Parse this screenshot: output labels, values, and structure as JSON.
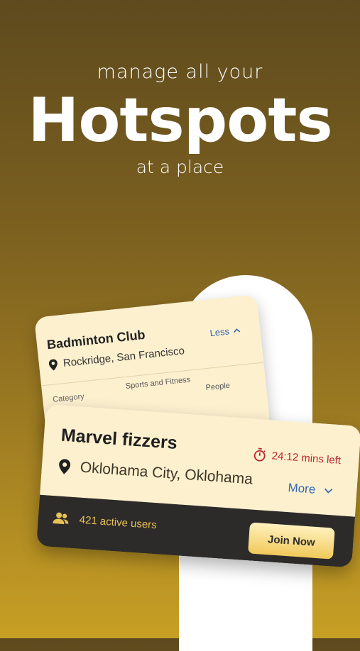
{
  "hero": {
    "line1": "manage all your",
    "line2": "Hotspots",
    "line3": "at a place"
  },
  "back_card": {
    "title": "Badminton Club",
    "location": "Rockridge, San Francisco",
    "toggle_label": "Less",
    "category_label": "Category",
    "category_value": "Sports and Fitness",
    "people_label": "People"
  },
  "front_card": {
    "title": "Marvel fizzers",
    "timer": "24:12 mins left",
    "location": "Oklohama City, Oklohama",
    "toggle_label": "More",
    "active_users": "421 active users",
    "join_label": "Join Now"
  },
  "colors": {
    "card_bg": "#fdf0cf",
    "card_footer": "#2d2b29",
    "link_blue": "#3366b3",
    "timer_red": "#b8292f",
    "users_gold": "#e8c055"
  },
  "icons": {
    "location": "location-pin-icon",
    "timer": "stopwatch-icon",
    "users": "users-icon",
    "chevron_up": "chevron-up-icon",
    "chevron_down": "chevron-down-icon"
  }
}
